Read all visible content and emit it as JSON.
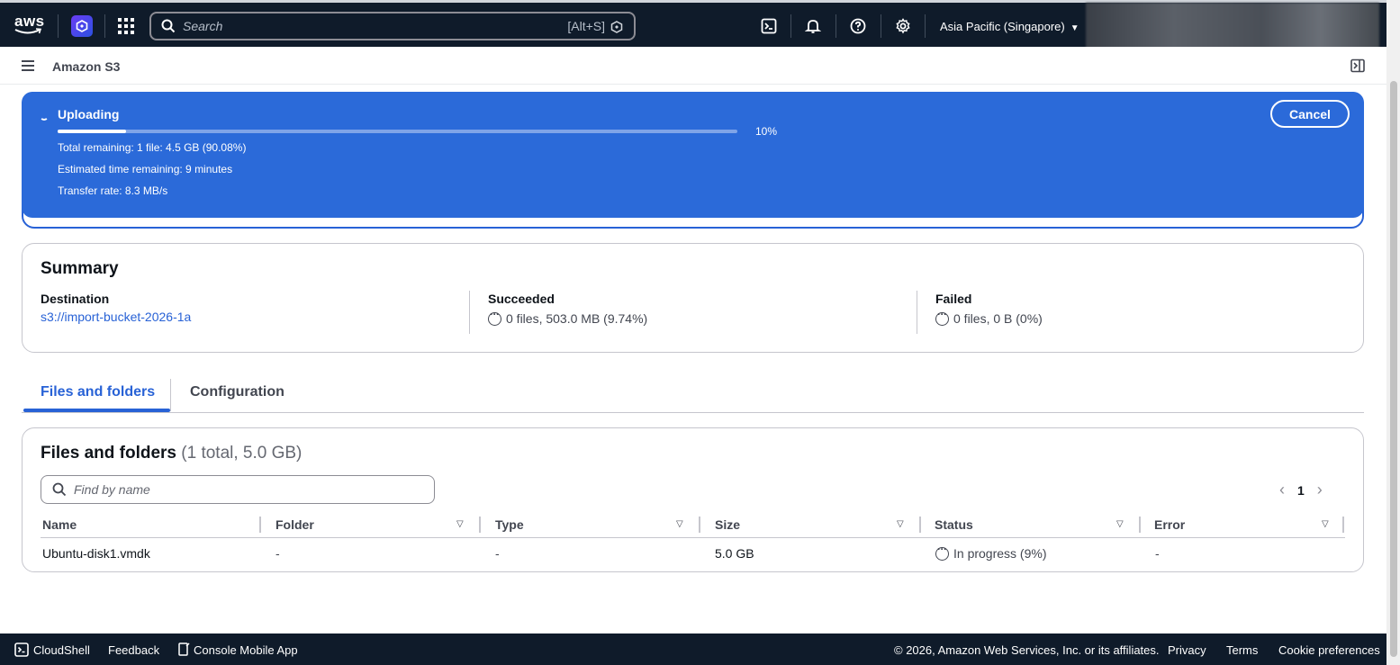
{
  "topnav": {
    "logo_text": "aws",
    "search_placeholder": "Search",
    "search_shortcut": "[Alt+S]",
    "region": "Asia Pacific (Singapore)"
  },
  "service": {
    "title": "Amazon S3"
  },
  "upload": {
    "title": "Uploading",
    "progress": 0.1,
    "percent_label": "10%",
    "total_remaining": "Total remaining: 1 file: 4.5 GB (90.08%)",
    "time_remaining": "Estimated time remaining: 9 minutes",
    "transfer_rate": "Transfer rate: 8.3 MB/s",
    "cancel_label": "Cancel"
  },
  "summary": {
    "title": "Summary",
    "destination_label": "Destination",
    "destination_value": "s3://import-bucket-2026-1a",
    "succeeded_label": "Succeeded",
    "succeeded_value": "0 files, 503.0 MB (9.74%)",
    "failed_label": "Failed",
    "failed_value": "0 files, 0 B (0%)"
  },
  "tabs": [
    {
      "label": "Files and folders",
      "active": true
    },
    {
      "label": "Configuration",
      "active": false
    }
  ],
  "files": {
    "title": "Files and folders",
    "count": "(1 total, 5.0 GB)",
    "search_placeholder": "Find by name",
    "page": "1",
    "columns": [
      "Name",
      "Folder",
      "Type",
      "Size",
      "Status",
      "Error"
    ],
    "rows": [
      {
        "name": "Ubuntu-disk1.vmdk",
        "folder": "-",
        "type": "-",
        "size": "5.0 GB",
        "status": "In progress (9%)",
        "error": "-"
      }
    ]
  },
  "footer": {
    "cloudshell": "CloudShell",
    "feedback": "Feedback",
    "mobile_app": "Console Mobile App",
    "copyright": "© 2026, Amazon Web Services, Inc. or its affiliates.",
    "privacy": "Privacy",
    "terms": "Terms",
    "cookie": "Cookie preferences"
  },
  "colors": {
    "nav_bg": "#0f1b2a",
    "flash_bg": "#2b6ad9",
    "link": "#2862d6"
  }
}
